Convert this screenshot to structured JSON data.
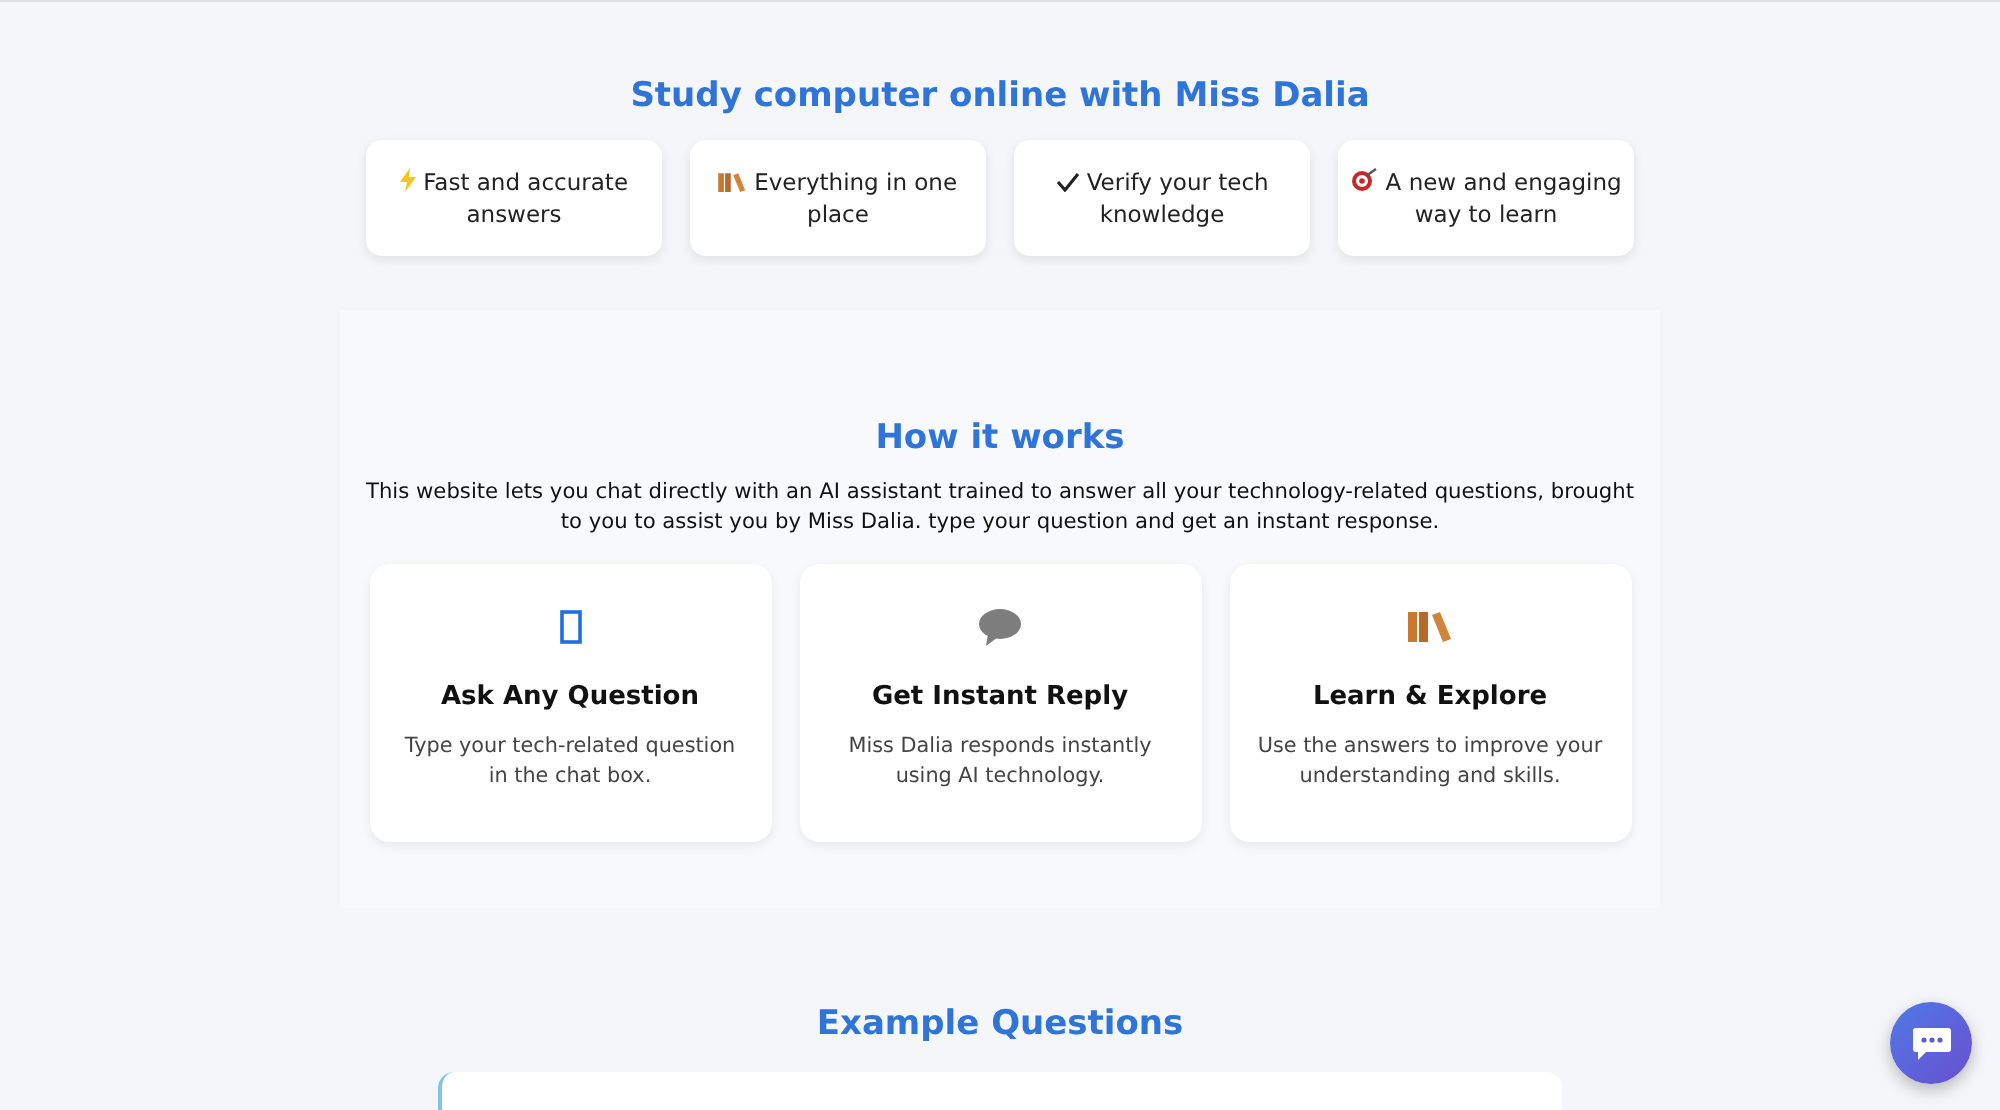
{
  "title": "Study computer online with Miss Dalia",
  "features": [
    {
      "text": "Fast and accurate answers"
    },
    {
      "text": "Everything in one place"
    },
    {
      "text": "Verify your tech knowledge"
    },
    {
      "text": "A new and engaging way to learn"
    }
  ],
  "how_it_works": {
    "heading": "How it works",
    "description": "This website lets you chat directly with an AI assistant trained to answer all your technology-related questions, brought to you to assist you by Miss Dalia. type your question and get an instant response.",
    "steps": [
      {
        "title": "Ask Any Question",
        "text": "Type your tech-related question in the chat box."
      },
      {
        "title": "Get Instant Reply",
        "text": "Miss Dalia responds instantly using AI technology."
      },
      {
        "title": "Learn & Explore",
        "text": "Use the answers to improve your understanding and skills."
      }
    ]
  },
  "examples": {
    "heading": "Example Questions"
  }
}
